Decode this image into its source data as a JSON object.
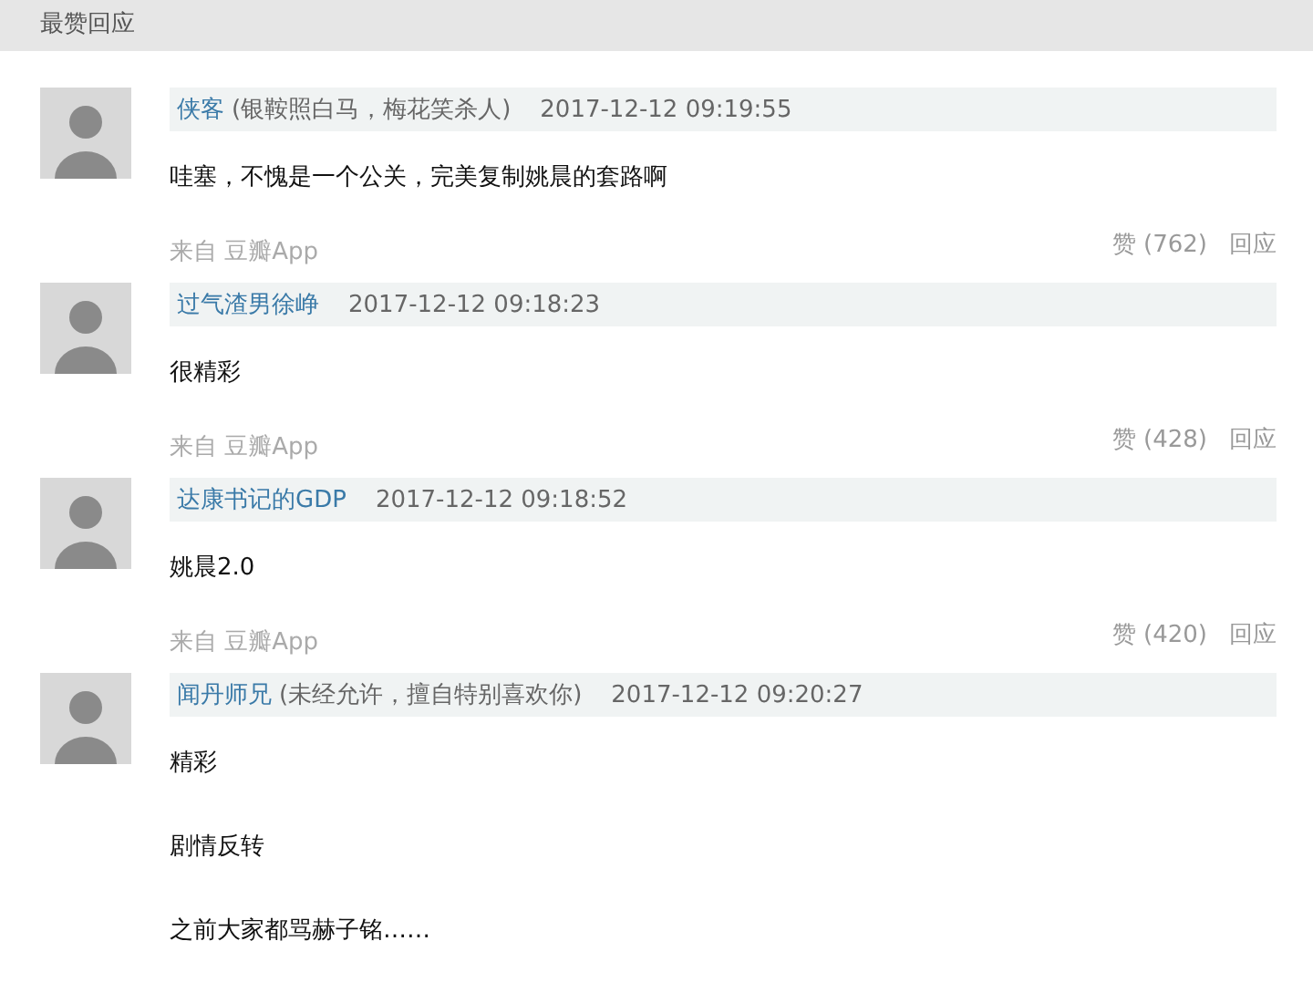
{
  "section_title": "最赞回应",
  "comments": [
    {
      "author": "侠客",
      "signature": "(银鞍照白马，梅花笑杀人)",
      "time": "2017-12-12 09:19:55",
      "paragraphs": [
        "哇塞，不愧是一个公关，完美复制姚晨的套路啊"
      ],
      "source": "来自 豆瓣App",
      "like": "赞 (762)",
      "reply": "回应"
    },
    {
      "author": "过气渣男徐峥",
      "time": "2017-12-12 09:18:23",
      "paragraphs": [
        "很精彩"
      ],
      "source": "来自 豆瓣App",
      "like": "赞 (428)",
      "reply": "回应"
    },
    {
      "author": "达康书记的GDP",
      "time": "2017-12-12 09:18:52",
      "paragraphs": [
        "姚晨2.0"
      ],
      "source": "来自 豆瓣App",
      "like": "赞 (420)",
      "reply": "回应"
    },
    {
      "author": "闻丹师兄",
      "signature": "(未经允许，擅自特别喜欢你)",
      "time": "2017-12-12 09:20:27",
      "paragraphs": [
        "精彩",
        "剧情反转",
        "之前大家都骂赫子铭……"
      ]
    }
  ]
}
